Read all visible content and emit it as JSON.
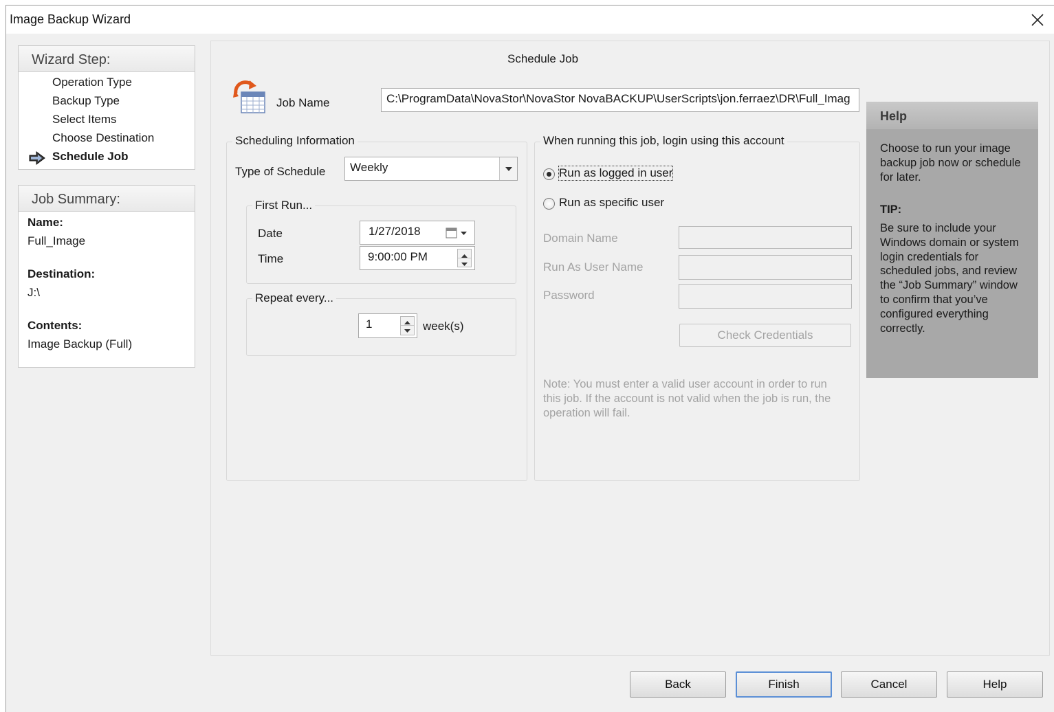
{
  "window": {
    "title": "Image Backup Wizard"
  },
  "wizard_steps": {
    "heading": "Wizard Step:",
    "items": [
      {
        "label": "Operation Type"
      },
      {
        "label": "Backup Type"
      },
      {
        "label": "Select Items"
      },
      {
        "label": "Choose Destination"
      },
      {
        "label": "Schedule Job"
      }
    ]
  },
  "job_summary": {
    "heading": "Job Summary:",
    "name_label": "Name:",
    "name_value": "Full_Image",
    "destination_label": "Destination:",
    "destination_value": "J:\\",
    "contents_label": "Contents:",
    "contents_value": "Image Backup (Full)"
  },
  "main": {
    "title": "Schedule Job",
    "job_name_label": "Job Name",
    "job_name_value": "C:\\ProgramData\\NovaStor\\NovaStor NovaBACKUP\\UserScripts\\jon.ferraez\\DR\\Full_Imag"
  },
  "scheduling": {
    "group_title": "Scheduling Information",
    "type_label": "Type of Schedule",
    "type_value": "Weekly",
    "first_run_title": "First Run...",
    "date_label": "Date",
    "date_value": "1/27/2018",
    "time_label": "Time",
    "time_value": "9:00:00 PM",
    "repeat_title": "Repeat every...",
    "repeat_value": "1",
    "repeat_unit": "week(s)"
  },
  "account": {
    "group_title": "When running this job, login using this account",
    "option_logged_in": "Run as logged in user",
    "option_specific": "Run as specific user",
    "selected": "logged_in",
    "domain_label": "Domain Name",
    "domain_value": "",
    "user_label": "Run As User Name",
    "user_value": "",
    "password_label": "Password",
    "password_value": "",
    "check_button": "Check Credentials",
    "note": "Note: You must enter a valid user account in order to run this job. If the account is not valid when the job is run, the operation will fail."
  },
  "help": {
    "heading": "Help",
    "body": "Choose to run your image backup job now or schedule for later.",
    "tip_heading": "TIP:",
    "tip_body": "Be sure to include your Windows domain or system login credentials for scheduled jobs, and review the “Job Summary” window to confirm that you’ve configured everything correctly."
  },
  "footer": {
    "back": "Back",
    "finish": "Finish",
    "cancel": "Cancel",
    "help": "Help"
  }
}
